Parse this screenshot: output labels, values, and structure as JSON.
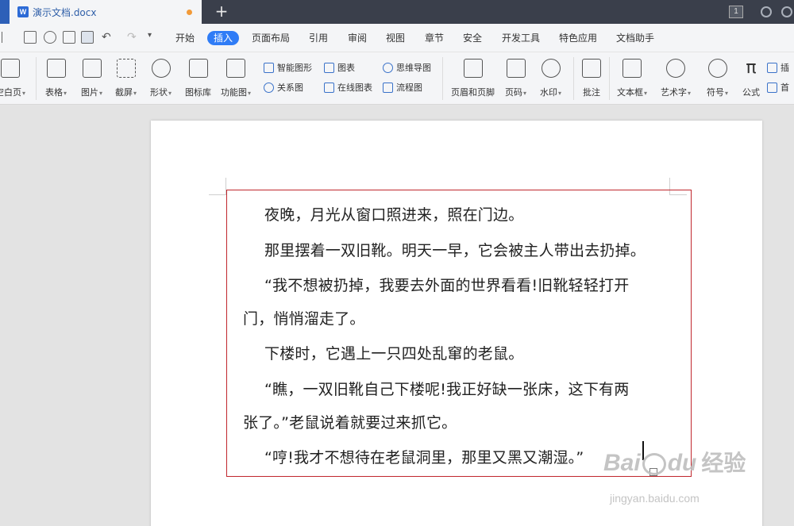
{
  "titlebar": {
    "doc_icon": "W",
    "doc_name": "演示文档.docx",
    "new_tab": "+",
    "page_badge": "1"
  },
  "menu": [
    "开始",
    "插入",
    "页面布局",
    "引用",
    "审阅",
    "视图",
    "章节",
    "安全",
    "开发工具",
    "特色应用",
    "文档助手"
  ],
  "active_menu": "插入",
  "ribbon": {
    "blank_page": "空白页",
    "table": "表格",
    "picture": "图片",
    "screenshot": "截屏",
    "shape": "形状",
    "icon_lib": "图标库",
    "func_chart": "功能图",
    "smart_shape": "智能图形",
    "chart": "图表",
    "mind_map": "思维导图",
    "relation": "关系图",
    "online_chart": "在线图表",
    "flowchart": "流程图",
    "header_footer": "页眉和页脚",
    "page_num": "页码",
    "watermark": "水印",
    "comment": "批注",
    "textbox": "文本框",
    "wordart": "艺术字",
    "symbol": "符号",
    "formula": "公式",
    "insert_num": "插",
    "first_letter": "首"
  },
  "document": {
    "paragraphs": [
      "夜晚，月光从窗口照进来，照在门边。",
      "那里摆着一双旧靴。明天一早，它会被主人带出去扔掉。",
      "“我不想被扔掉，我要去外面的世界看看!旧靴轻轻打开",
      "门，悄悄溜走了。",
      "下楼时，它遇上一只四处乱窜的老鼠。",
      "“瞧，一双旧靴自己下楼呢!我正好缺一张床，这下有两",
      "张了。”老鼠说着就要过来抓它。",
      "“哼!我才不想待在老鼠洞里，那里又黑又潮湿。”"
    ]
  },
  "watermark": {
    "brand": "Bai",
    "brand2": "du",
    "cn": "经验",
    "url": "jingyan.baidu.com"
  },
  "colors": {
    "accent": "#2f7cf6",
    "textbox_border": "#c0272d",
    "titlebar": "#3a3f4b"
  }
}
